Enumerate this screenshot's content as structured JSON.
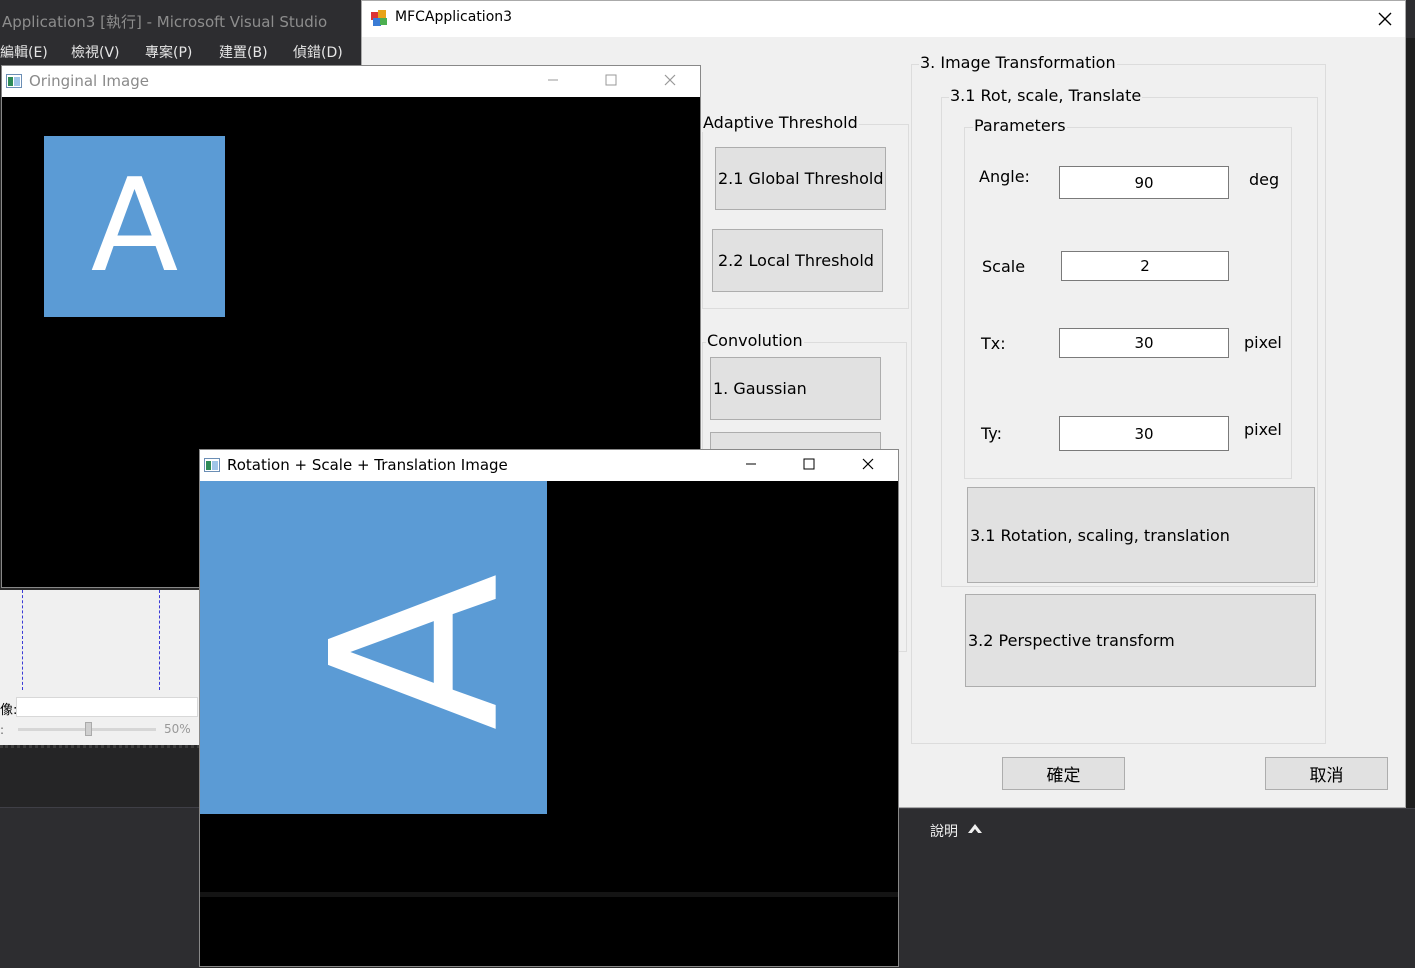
{
  "vs": {
    "title": "Application3 [執行] - Microsoft Visual Studio",
    "menu": [
      "編輯(E)",
      "檢視(V)",
      "專案(P)",
      "建置(B)",
      "偵錯(D)"
    ],
    "bottom_label": "像:",
    "colon": ":",
    "zoom": "50%",
    "zoom_level": 0.5,
    "help": "說明"
  },
  "dialog": {
    "title": "MFCApplication3",
    "adaptive_threshold": {
      "caption": "Adaptive  Threshold",
      "global_button": "2.1 Global Threshold",
      "local_button": "2.2 Local Threshold"
    },
    "convolution": {
      "caption": "Convolution",
      "gaussian_button": "1. Gaussian"
    },
    "image_transformation": {
      "caption": "3. Image Transformation",
      "rst_group": "3.1 Rot, scale, Translate",
      "parameters": {
        "caption": "Parameters",
        "angle_label": "Angle:",
        "angle_value": "90",
        "angle_unit": "deg",
        "scale_label": "Scale",
        "scale_value": "2",
        "tx_label": "Tx:",
        "tx_value": "30",
        "tx_unit": "pixel",
        "ty_label": "Ty:",
        "ty_value": "30",
        "ty_unit": "pixel"
      },
      "rst_button": "3.1 Rotation, scaling, translation",
      "perspective_button": "3.2 Perspective transform"
    },
    "ok_button": "確定",
    "cancel_button": "取消"
  },
  "original_window": {
    "title": "Oringinal Image",
    "glyph": "A"
  },
  "rst_window": {
    "title": "Rotation + Scale + Translation Image",
    "glyph": "A"
  },
  "colors": {
    "image_blue": "#5b9bd5",
    "vs_dark": "#2d2d30",
    "dialog_bg": "#f0f0f0",
    "button_bg": "#e1e1e1"
  }
}
